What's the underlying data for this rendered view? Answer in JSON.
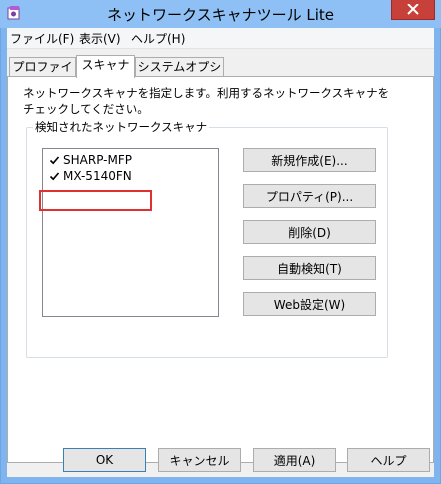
{
  "window": {
    "title": "ネットワークスキャナツール Lite"
  },
  "menu": {
    "items": [
      {
        "label": "ファイル(F)"
      },
      {
        "label": "表示(V)"
      },
      {
        "label": "ヘルプ(H)"
      }
    ]
  },
  "tabs": [
    {
      "label": "プロファイル"
    },
    {
      "label": "スキャナ"
    },
    {
      "label": "システムオプション"
    }
  ],
  "scanner_tab": {
    "description": "ネットワークスキャナを指定します。利用するネットワークスキャナをチェックしてください。",
    "group_label": "検知されたネットワークスキャナ",
    "scanners": [
      {
        "name": "SHARP-MFP",
        "checked": true
      },
      {
        "name": "MX-5140FN",
        "checked": true
      }
    ],
    "buttons": {
      "new": "新規作成(E)...",
      "properties": "プロパティ(P)...",
      "delete": "削除(D)",
      "auto_detect": "自動検知(T)",
      "web_settings": "Web設定(W)"
    }
  },
  "dialog_buttons": {
    "ok": "OK",
    "cancel": "キャンセル",
    "apply": "適用(A)",
    "help": "ヘルプ"
  },
  "colors": {
    "titlebar": "#8ec0f5",
    "close_button": "#c7403a",
    "highlight_box": "#e03030"
  }
}
